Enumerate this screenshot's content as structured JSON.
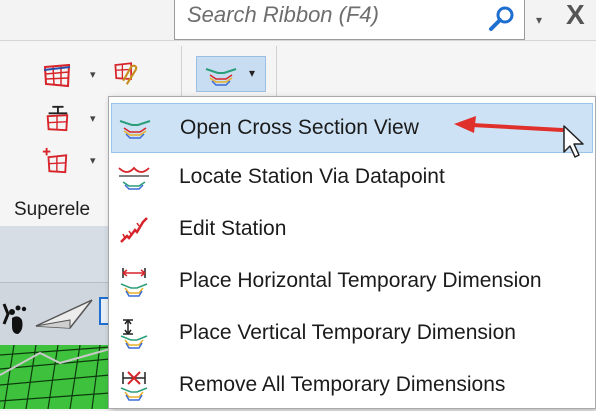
{
  "search": {
    "placeholder": "Search Ribbon (F4)"
  },
  "ribbon": {
    "group_label": "Superele",
    "caret": "▾"
  },
  "menu": {
    "items": [
      {
        "label": "Open Cross Section View",
        "icon": "cross-section-view-icon",
        "highlighted": true
      },
      {
        "label": "Locate Station Via Datapoint",
        "icon": "locate-station-icon"
      },
      {
        "label": "Edit Station",
        "icon": "edit-station-icon"
      },
      {
        "label": "Place Horizontal Temporary Dimension",
        "icon": "horizontal-dimension-icon"
      },
      {
        "label": "Place Vertical Temporary Dimension",
        "icon": "vertical-dimension-icon"
      },
      {
        "label": "Remove All Temporary Dimensions",
        "icon": "remove-dimensions-icon"
      }
    ]
  },
  "colors": {
    "highlight": "#cde3f5",
    "arrow": "#e0302c",
    "accent": "#9cc4e8"
  }
}
